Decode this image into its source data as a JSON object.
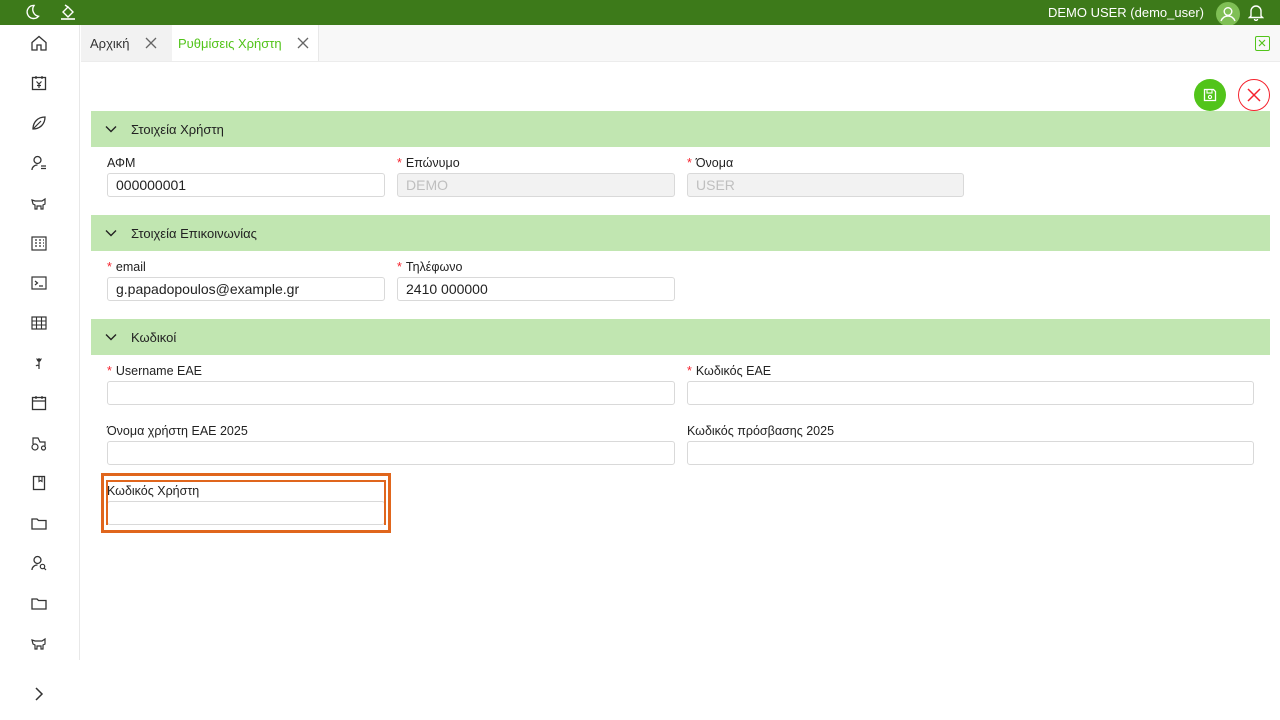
{
  "topbar": {
    "user_name": "DEMO USER (demo_user)",
    "bg_color": "#3d7a1a",
    "icons": [
      "moon-icon",
      "paint-bucket-icon",
      "user-avatar-icon",
      "bell-icon"
    ]
  },
  "sidebar": {
    "items": [
      {
        "icon": "home-icon"
      },
      {
        "icon": "yen-calendar-icon"
      },
      {
        "icon": "leaf-icon"
      },
      {
        "icon": "user-list-icon"
      },
      {
        "icon": "cow-icon"
      },
      {
        "icon": "building-icon"
      },
      {
        "icon": "terminal-icon"
      },
      {
        "icon": "table-icon"
      },
      {
        "icon": "tulip-icon"
      },
      {
        "icon": "calendar-icon"
      },
      {
        "icon": "tractor-icon"
      },
      {
        "icon": "book-icon"
      },
      {
        "icon": "folder-icon"
      },
      {
        "icon": "user-search-icon"
      },
      {
        "icon": "folder-icon"
      },
      {
        "icon": "cow-icon"
      }
    ],
    "expand_icon": "chevron-right-icon"
  },
  "tabs": [
    {
      "label": "Αρχική",
      "active": false
    },
    {
      "label": "Ρυθμίσεις Χρήστη",
      "active": true
    }
  ],
  "accent_color": "#52c41a",
  "sections": {
    "user": {
      "title": "Στοιχεία Χρήστη",
      "afm_label": "ΑΦΜ",
      "afm_value": "000000001",
      "surname_label": "Επώνυμο",
      "surname_value": "DEMO",
      "name_label": "Όνομα",
      "name_value": "USER"
    },
    "contact": {
      "title": "Στοιχεία Επικοινωνίας",
      "email_label": "email",
      "email_value": "g.papadopoulos@example.gr",
      "phone_label": "Τηλέφωνο",
      "phone_value": "2410 000000"
    },
    "codes": {
      "title": "Κωδικοί",
      "username_eae_label": "Username ΕΑΕ",
      "username_eae_value": "",
      "code_eae_label": "Κωδικός ΕΑΕ",
      "code_eae_value": "",
      "username_2025_label": "Όνομα χρήστη ΕΑΕ 2025",
      "username_2025_value": "",
      "password_2025_label": "Κωδικός πρόσβασης 2025",
      "password_2025_value": "",
      "user_code_label": "Κωδικός Χρήστη",
      "user_code_value": ""
    }
  },
  "required_marker": "*"
}
